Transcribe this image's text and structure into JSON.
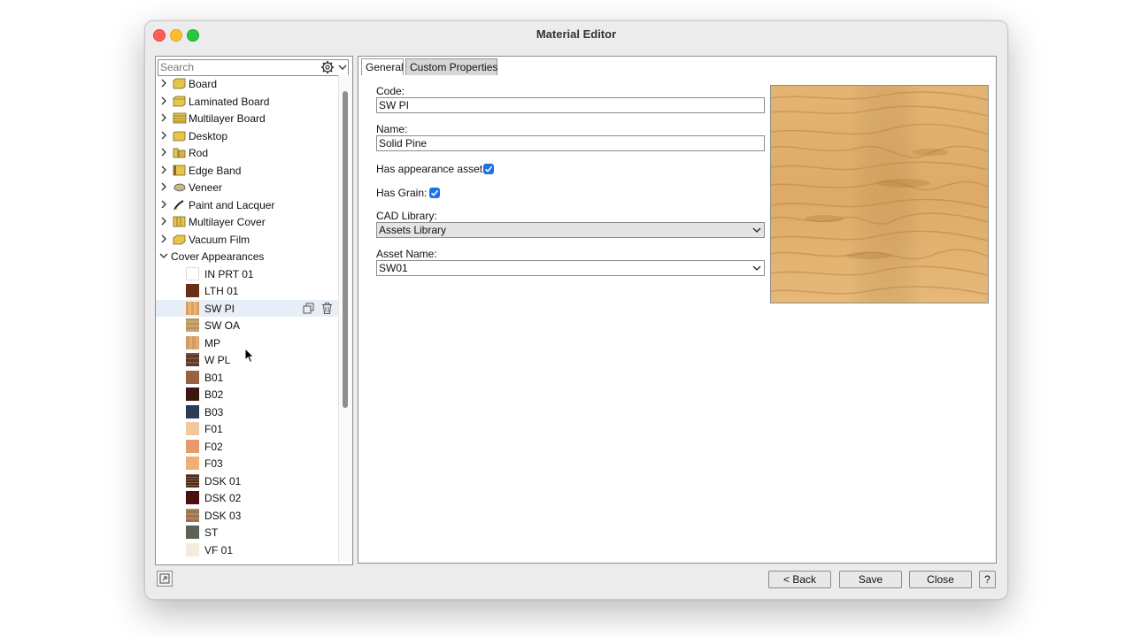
{
  "window": {
    "title": "Material Editor"
  },
  "search": {
    "placeholder": "Search",
    "value": ""
  },
  "categories": [
    {
      "label": "Board",
      "icon": "board-icon"
    },
    {
      "label": "Laminated Board",
      "icon": "laminated-board-icon"
    },
    {
      "label": "Multilayer Board",
      "icon": "multilayer-board-icon"
    },
    {
      "label": "Desktop",
      "icon": "desktop-icon"
    },
    {
      "label": "Rod",
      "icon": "rod-icon"
    },
    {
      "label": "Edge Band",
      "icon": "edge-band-icon"
    },
    {
      "label": "Veneer",
      "icon": "veneer-icon"
    },
    {
      "label": "Paint and Lacquer",
      "icon": "paint-icon"
    },
    {
      "label": "Multilayer Cover",
      "icon": "multilayer-cover-icon"
    },
    {
      "label": "Vacuum Film",
      "icon": "vacuum-film-icon"
    },
    {
      "label": "Cover Appearances",
      "icon": "",
      "expanded": true
    }
  ],
  "cover_items": [
    {
      "label": "IN PRT 01",
      "color": "#ffffff"
    },
    {
      "label": "LTH 01",
      "color": "#6b2e12"
    },
    {
      "label": "SW PI",
      "color": "#d9a05e",
      "selected": true
    },
    {
      "label": "SW OA",
      "color": "#c9a46f"
    },
    {
      "label": "MP",
      "color": "#d39b63"
    },
    {
      "label": "W PL",
      "color": "#5b3b2c"
    },
    {
      "label": "B01",
      "color": "#9a6245"
    },
    {
      "label": "B02",
      "color": "#3a170f"
    },
    {
      "label": "B03",
      "color": "#2b3a55"
    },
    {
      "label": "F01",
      "color": "#f2c8a0"
    },
    {
      "label": "F02",
      "color": "#e79b6b"
    },
    {
      "label": "F03",
      "color": "#f0b073"
    },
    {
      "label": "DSK 01",
      "color": "#4a2c1d"
    },
    {
      "label": "DSK 02",
      "color": "#4a0e0e"
    },
    {
      "label": "DSK 03",
      "color": "#9a7450"
    },
    {
      "label": "ST",
      "color": "#5b6256"
    },
    {
      "label": "VF 01",
      "color": "#f6eadc"
    }
  ],
  "tabs": {
    "general": "General",
    "custom": "Custom Properties"
  },
  "form": {
    "code_label": "Code:",
    "code_value": "SW PI",
    "name_label": "Name:",
    "name_value": "Solid Pine",
    "has_appearance_label": "Has appearance asset",
    "has_appearance_checked": true,
    "has_grain_label": "Has Grain:",
    "has_grain_checked": true,
    "cad_library_label": "CAD Library:",
    "cad_library_value": "Assets Library",
    "asset_name_label": "Asset Name:",
    "asset_name_value": "SW01"
  },
  "buttons": {
    "back": "< Back",
    "save": "Save",
    "close": "Close",
    "help": "?"
  },
  "colors": {
    "accent": "#1a73e8",
    "selection": "#e8eef7",
    "wood_base": "#e3b06b"
  }
}
